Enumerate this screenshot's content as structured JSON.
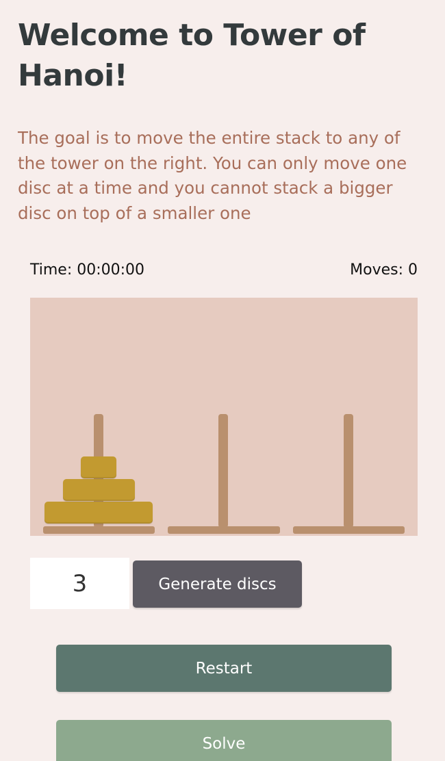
{
  "header": {
    "title": "Welcome to Tower of Hanoi!",
    "description": "The goal is to move the entire stack to any of the tower on the right. You can only move one disc at a time and you cannot stack a bigger disc on top of a smaller one"
  },
  "stats": {
    "time": "Time: 00:00:00",
    "moves": "Moves: 0"
  },
  "game": {
    "tower_count": 3,
    "disc_count": 3,
    "towers": [
      {
        "name": "tower-1",
        "discs": [
          3,
          2,
          1
        ]
      },
      {
        "name": "tower-2",
        "discs": []
      },
      {
        "name": "tower-3",
        "discs": []
      }
    ]
  },
  "controls": {
    "disc_input_value": "3",
    "generate_label": "Generate discs",
    "restart_label": "Restart",
    "solve_label": "Solve"
  },
  "colors": {
    "background": "#f7eeec",
    "board": "#e6cbc0",
    "rod": "#b9906e",
    "disc": "#c29a30",
    "title": "#333a3c",
    "description": "#a86e5a",
    "generate_button": "#5d5a62",
    "restart_button": "#5c776f",
    "solve_button": "#8da98e"
  }
}
